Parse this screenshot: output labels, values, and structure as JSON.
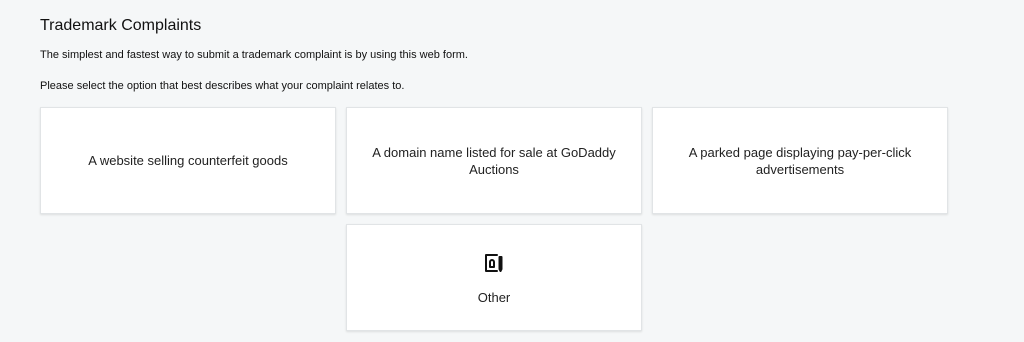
{
  "page": {
    "title": "Trademark Complaints",
    "intro": "The simplest and fastest way to submit a trademark complaint is by using this web form.",
    "instruction": "Please select the option that best describes what your complaint relates to."
  },
  "options": [
    {
      "label": "A website selling counterfeit goods"
    },
    {
      "label": "A domain name listed for sale at GoDaddy Auctions"
    },
    {
      "label": "A parked page displaying pay-per-click advertisements"
    },
    {
      "label": "Other",
      "icon": "document-pencil-icon"
    }
  ],
  "colors": {
    "background": "#f5f7f8",
    "card": "#ffffff",
    "card_border": "#e1e4e6",
    "text": "#111111"
  }
}
